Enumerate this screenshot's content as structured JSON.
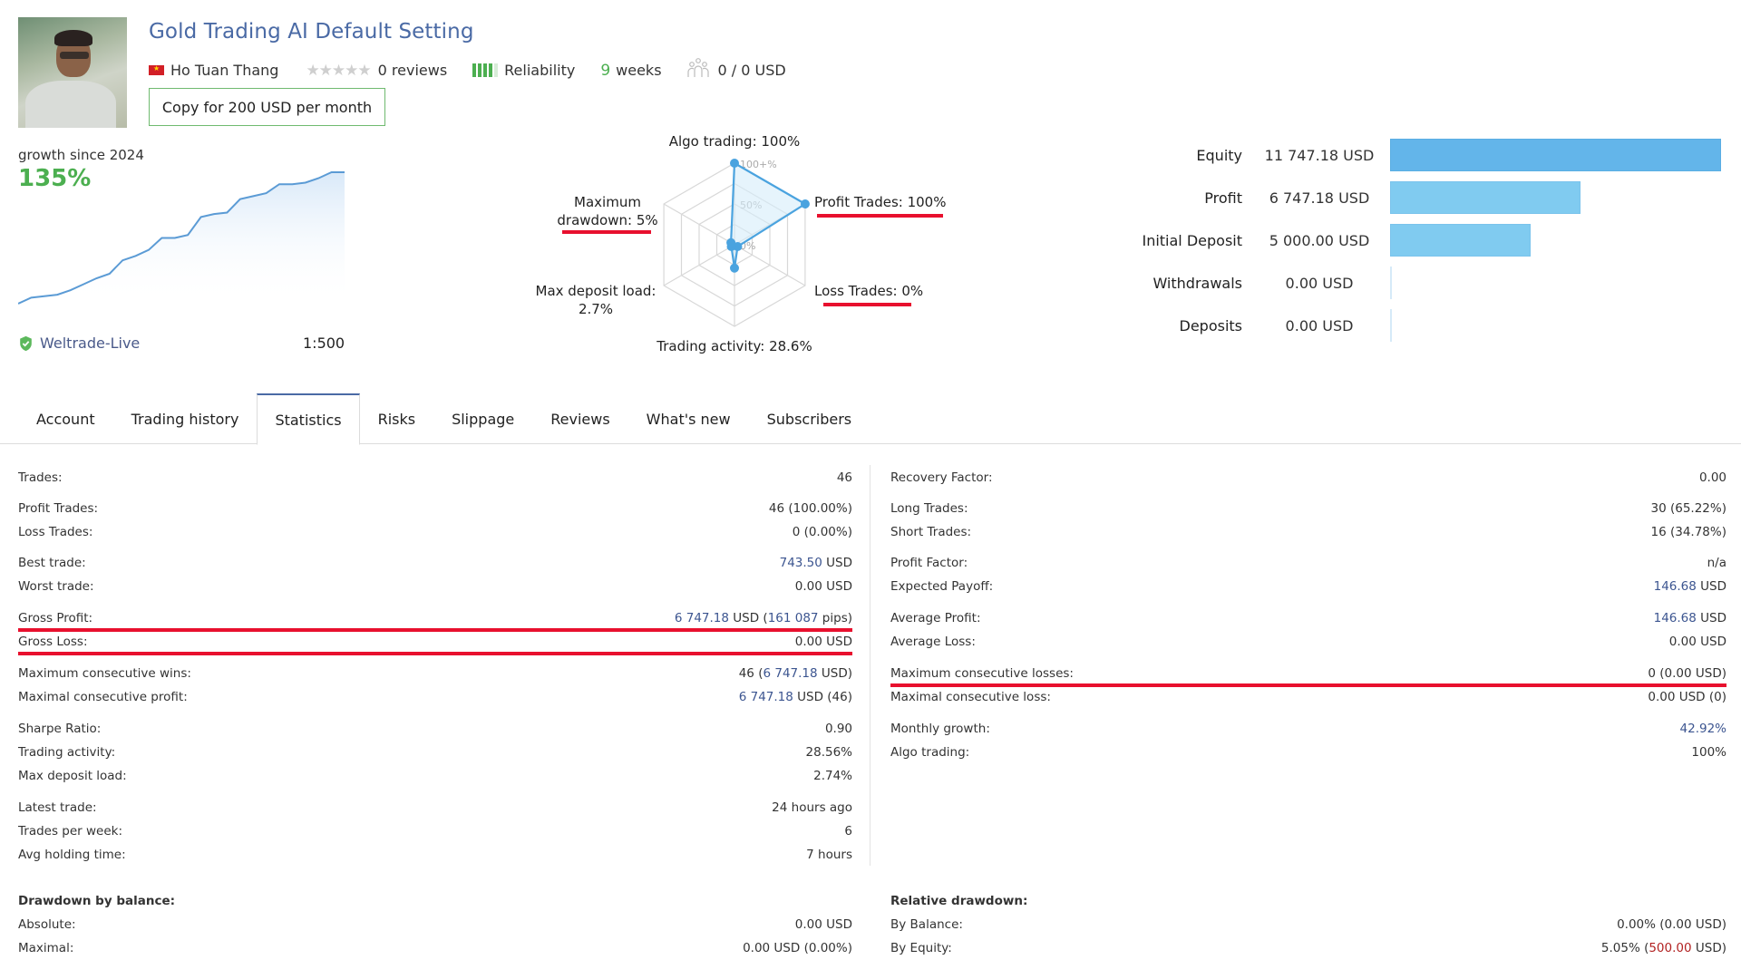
{
  "header": {
    "title": "Gold Trading AI Default Setting",
    "author": "Ho Tuan Thang",
    "author_flag": "vietnam-flag-icon",
    "rating_stars": 0,
    "rating_max": 5,
    "reviews": "0 reviews",
    "reliability_label": "Reliability",
    "reliability_level": 4,
    "reliability_max": 5,
    "weeks_num": "9",
    "weeks_label": "weeks",
    "subscribers": "0 / 0 USD",
    "copy_button": "Copy for 200 USD per month"
  },
  "growth": {
    "label": "growth since 2024",
    "value": "135%",
    "broker": "Weltrade-Live",
    "leverage": "1:500",
    "line_color": "#5b9bd5",
    "points": [
      0,
      4,
      5,
      6,
      9,
      13,
      17,
      20,
      29,
      32,
      36,
      44,
      44,
      46,
      58,
      60,
      61,
      70,
      72,
      74,
      80,
      80,
      81,
      84,
      88,
      88
    ]
  },
  "radar": {
    "ticks": [
      "100+%",
      "50%",
      "0%"
    ],
    "axes": [
      {
        "label": "Algo trading: 100%",
        "value": 100
      },
      {
        "label": "Profit Trades: 100%",
        "value": 100
      },
      {
        "label": "Loss Trades: 0%",
        "value": 0
      },
      {
        "label": "Trading activity: 28.6%",
        "value": 28.6
      },
      {
        "label_line1": "Max deposit load:",
        "label_line2": "2.7%",
        "value": 2.7
      },
      {
        "label_line1": "Maximum",
        "label_line2": "drawdown: 5%",
        "value": 5
      }
    ],
    "highlight_color": "#e8102e"
  },
  "finances": [
    {
      "label": "Equity",
      "value": "11 747.18 USD",
      "amount": 11747.18,
      "color": "#63b5ea"
    },
    {
      "label": "Profit",
      "value": "6 747.18 USD",
      "amount": 6747.18,
      "color": "#80cbf0"
    },
    {
      "label": "Initial Deposit",
      "value": "5 000.00 USD",
      "amount": 5000.0,
      "color": "#80cbf0"
    },
    {
      "label": "Withdrawals",
      "value": "0.00 USD",
      "amount": 0,
      "color": "#80cbf0"
    },
    {
      "label": "Deposits",
      "value": "0.00 USD",
      "amount": 0,
      "color": "#80cbf0"
    }
  ],
  "tabs": [
    {
      "label": "Account",
      "active": false
    },
    {
      "label": "Trading history",
      "active": false
    },
    {
      "label": "Statistics",
      "active": true
    },
    {
      "label": "Risks",
      "active": false
    },
    {
      "label": "Slippage",
      "active": false
    },
    {
      "label": "Reviews",
      "active": false
    },
    {
      "label": "What's new",
      "active": false
    },
    {
      "label": "Subscribers",
      "active": false
    }
  ],
  "stats_left": [
    {
      "label": "Trades:",
      "value": [
        {
          "t": "46"
        }
      ]
    },
    {
      "label": "Profit Trades:",
      "value": [
        {
          "t": "46 (100.00%)"
        }
      ]
    },
    {
      "label": "Loss Trades:",
      "value": [
        {
          "t": "0 (0.00%)"
        }
      ]
    },
    {
      "label": "Best trade:",
      "value": [
        {
          "t": "743.50",
          "c": "blue"
        },
        {
          "t": " USD"
        }
      ]
    },
    {
      "label": "Worst trade:",
      "value": [
        {
          "t": "0.00 USD"
        }
      ]
    },
    {
      "label": "Gross Profit:",
      "value": [
        {
          "t": "6 747.18",
          "c": "blue"
        },
        {
          "t": " USD ("
        },
        {
          "t": "161 087",
          "c": "blue"
        },
        {
          "t": " pips)"
        }
      ],
      "highlight": true
    },
    {
      "label": "Gross Loss:",
      "value": [
        {
          "t": "0.00 USD"
        }
      ],
      "highlight": true
    },
    {
      "label": "Maximum consecutive wins:",
      "value": [
        {
          "t": "46 ("
        },
        {
          "t": "6 747.18",
          "c": "blue"
        },
        {
          "t": " USD)"
        }
      ]
    },
    {
      "label": "Maximal consecutive profit:",
      "value": [
        {
          "t": "6 747.18",
          "c": "blue"
        },
        {
          "t": " USD (46)"
        }
      ]
    },
    {
      "label": "Sharpe Ratio:",
      "value": [
        {
          "t": "0.90"
        }
      ]
    },
    {
      "label": "Trading activity:",
      "value": [
        {
          "t": "28.56%"
        }
      ]
    },
    {
      "label": "Max deposit load:",
      "value": [
        {
          "t": "2.74%"
        }
      ]
    },
    {
      "label": "Latest trade:",
      "value": [
        {
          "t": "24 hours ago"
        }
      ]
    },
    {
      "label": "Trades per week:",
      "value": [
        {
          "t": "6"
        }
      ]
    },
    {
      "label": "Avg holding time:",
      "value": [
        {
          "t": "7 hours"
        }
      ]
    },
    {
      "label": "Drawdown by balance:",
      "value": [],
      "heading": true
    },
    {
      "label": "Absolute:",
      "value": [
        {
          "t": "0.00 USD"
        }
      ]
    },
    {
      "label": "Maximal:",
      "value": [
        {
          "t": "0.00 USD (0.00%)"
        }
      ]
    }
  ],
  "stats_right": [
    {
      "label": "Recovery Factor:",
      "value": [
        {
          "t": "0.00"
        }
      ]
    },
    {
      "label": "Long Trades:",
      "value": [
        {
          "t": "30 (65.22%)"
        }
      ]
    },
    {
      "label": "Short Trades:",
      "value": [
        {
          "t": "16 (34.78%)"
        }
      ]
    },
    {
      "label": "Profit Factor:",
      "value": [
        {
          "t": "n/a"
        }
      ]
    },
    {
      "label": "Expected Payoff:",
      "value": [
        {
          "t": "146.68",
          "c": "blue"
        },
        {
          "t": " USD"
        }
      ]
    },
    {
      "label": "Average Profit:",
      "value": [
        {
          "t": "146.68",
          "c": "blue"
        },
        {
          "t": " USD"
        }
      ]
    },
    {
      "label": "Average Loss:",
      "value": [
        {
          "t": "0.00 USD"
        }
      ]
    },
    {
      "label": "Maximum consecutive losses:",
      "value": [
        {
          "t": "0 (0.00 USD)"
        }
      ],
      "highlight": true
    },
    {
      "label": "Maximal consecutive loss:",
      "value": [
        {
          "t": "0.00 USD (0)"
        }
      ]
    },
    {
      "label": "Monthly growth:",
      "value": [
        {
          "t": "42.92%",
          "c": "blue"
        }
      ]
    },
    {
      "label": "Algo trading:",
      "value": [
        {
          "t": "100%"
        }
      ]
    },
    {
      "label": "Relative drawdown:",
      "value": [],
      "heading": true
    },
    {
      "label": "By Balance:",
      "value": [
        {
          "t": "0.00% (0.00 USD)"
        }
      ]
    },
    {
      "label": "By Equity:",
      "value": [
        {
          "t": "5.05% ("
        },
        {
          "t": "500.00",
          "c": "red"
        },
        {
          "t": " USD)"
        }
      ]
    }
  ]
}
